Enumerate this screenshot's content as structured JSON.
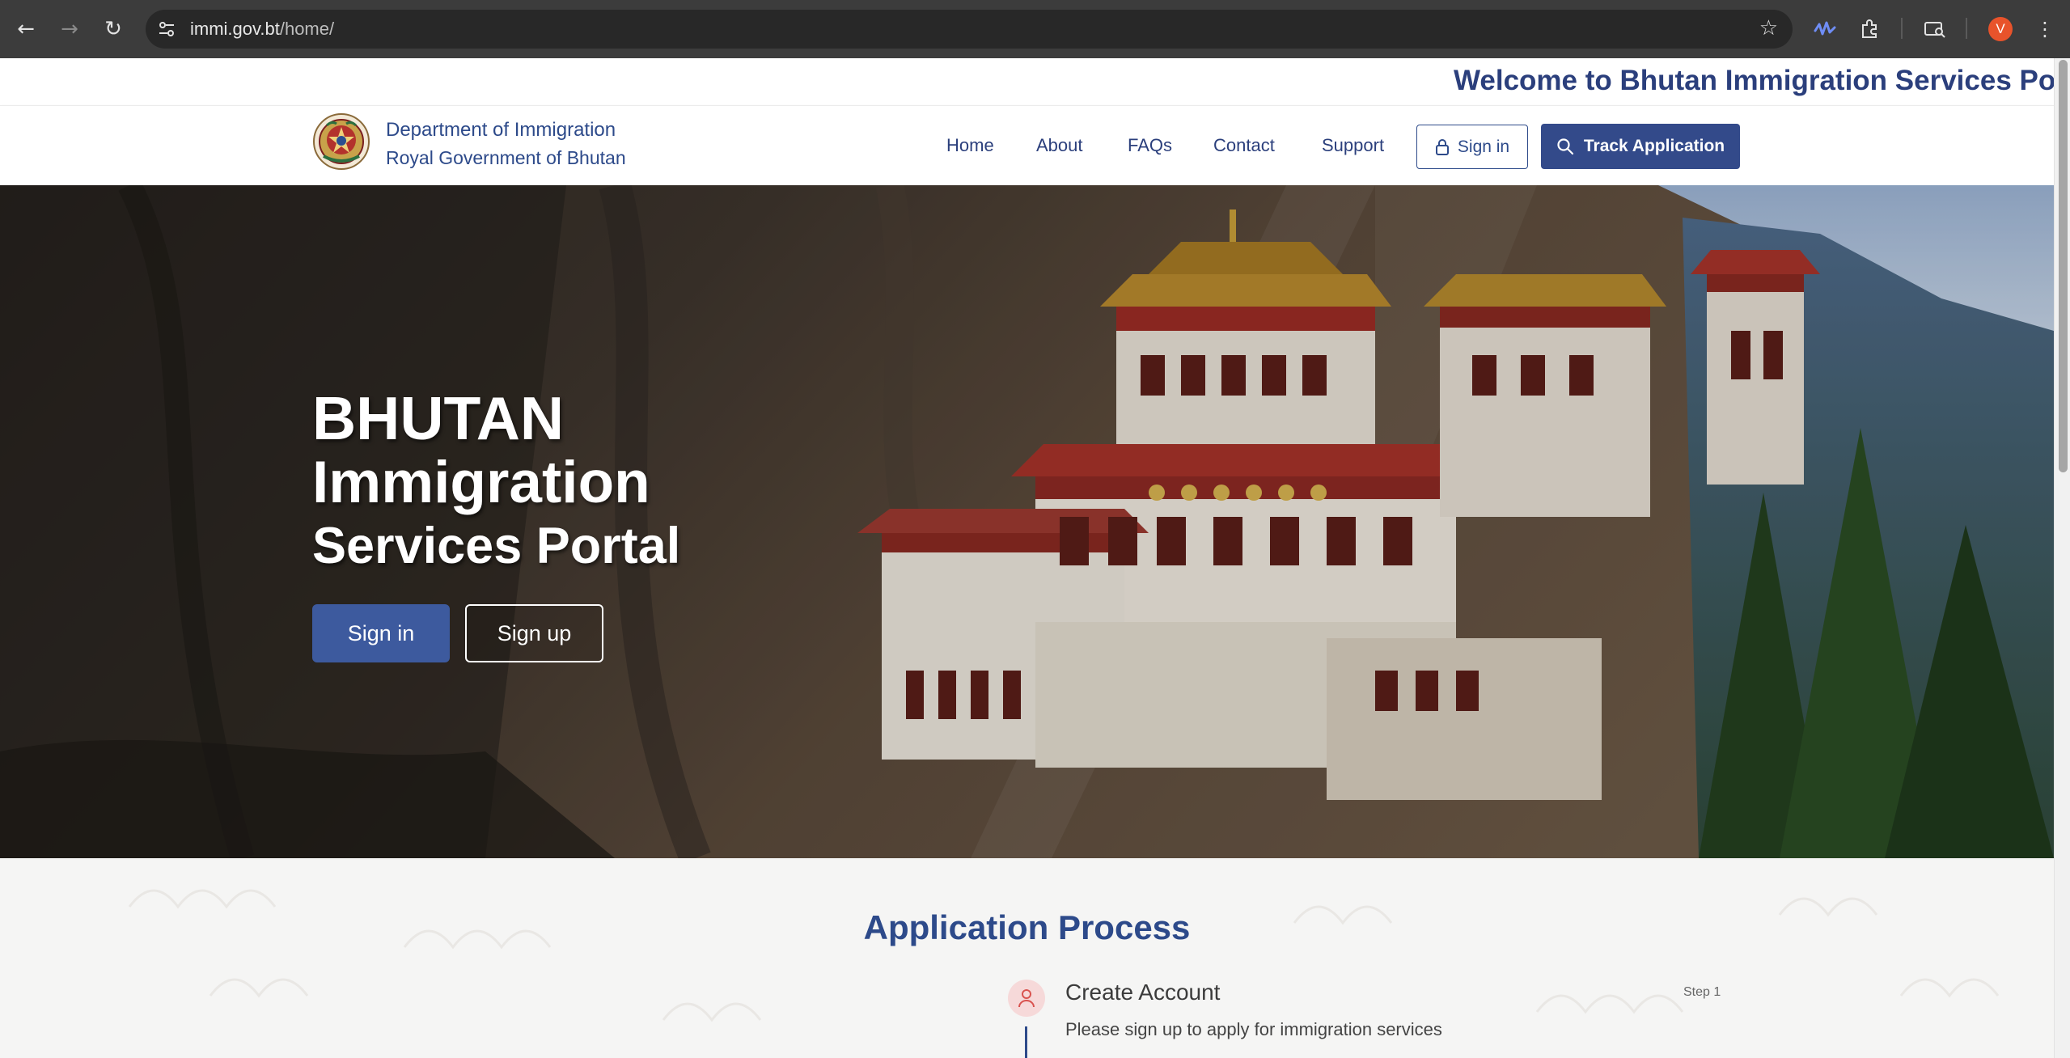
{
  "browser": {
    "url_host": "immi.gov.bt",
    "url_path": "/home/",
    "profile_initial": "V"
  },
  "marquee": {
    "text": "Welcome to Bhutan Immigration Services Portal"
  },
  "header": {
    "org_name": "Department of Immigration",
    "org_sub": "Royal Government of Bhutan",
    "nav": [
      "Home",
      "About",
      "FAQs",
      "Contact",
      "Support"
    ],
    "signin_label": "Sign in",
    "track_label": "Track Application"
  },
  "hero": {
    "line1": "BHUTAN",
    "line2": "Immigration",
    "line3": "Services Portal",
    "signin_label": "Sign in",
    "signup_label": "Sign up"
  },
  "process": {
    "title": "Application Process",
    "steps": [
      {
        "title": "Create Account",
        "description": "Please sign up to apply for immigration services",
        "step_label": "Step 1"
      }
    ]
  },
  "colors": {
    "brand_blue": "#2d4a8a",
    "button_blue": "#334a8a",
    "step_icon_bg": "#f6d9d9",
    "step_icon_fg": "#d9534f"
  }
}
